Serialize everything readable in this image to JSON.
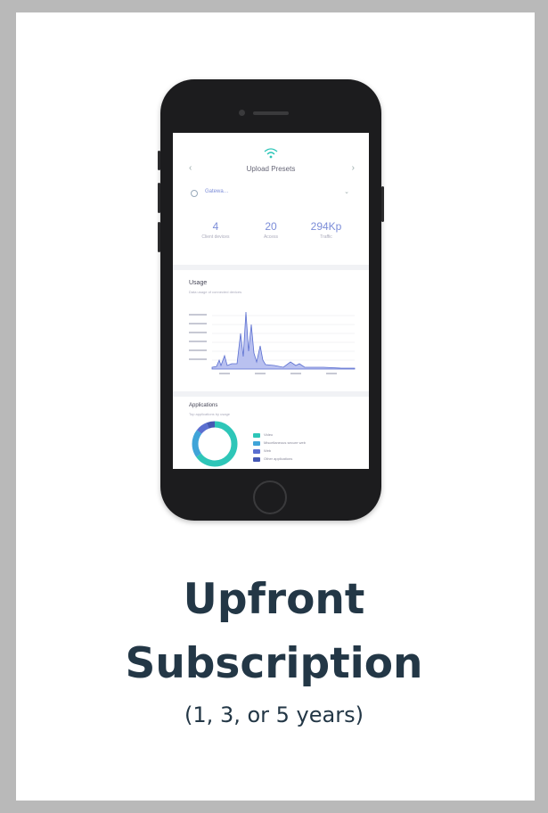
{
  "headline": {
    "line1": "Upfront",
    "line2": "Subscription",
    "sub": "(1, 3, or 5 years)"
  },
  "phone_screen": {
    "title": "Upload Presets",
    "selector_label": "Gatewa…",
    "stats": [
      {
        "value": "4",
        "label": "Client devices"
      },
      {
        "value": "20",
        "label": "Access"
      },
      {
        "value": "294Kp",
        "label": "Traffic"
      }
    ],
    "usage_title": "Usage",
    "usage_sub": "Data usage of connected devices",
    "apps_title": "Applications",
    "apps_sub": "Top applications by usage",
    "legend": [
      {
        "label": "Video",
        "color": "#2ec6b8"
      },
      {
        "label": "Miscellaneous secure web",
        "color": "#3fa4d8"
      },
      {
        "label": "Web",
        "color": "#5b6fd0"
      },
      {
        "label": "Other applications",
        "color": "#4558b4"
      }
    ],
    "accent_color": "#7c8dd8"
  }
}
